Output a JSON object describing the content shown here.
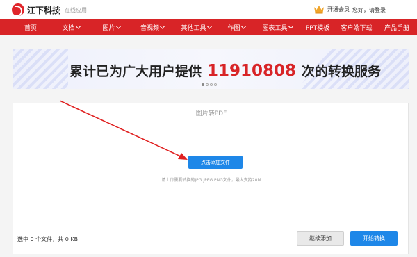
{
  "brand": {
    "name": "江下科技",
    "tagline": "在线应用",
    "accent": "#d82427",
    "blue": "#1e87e8"
  },
  "header": {
    "vip_label": "开通会员",
    "login_text": "您好，请登录",
    "vip_icon": "crown-icon"
  },
  "nav": {
    "items": [
      {
        "label": "首页",
        "dropdown": false
      },
      {
        "label": "文档",
        "dropdown": true
      },
      {
        "label": "图片",
        "dropdown": true
      },
      {
        "label": "音视频",
        "dropdown": true
      },
      {
        "label": "其他工具",
        "dropdown": true
      },
      {
        "label": "作图",
        "dropdown": true
      },
      {
        "label": "图表工具",
        "dropdown": true
      },
      {
        "label": "PPT模板",
        "dropdown": false
      },
      {
        "label": "客户端下载",
        "dropdown": false
      },
      {
        "label": "产品手册",
        "dropdown": false
      }
    ]
  },
  "banner": {
    "prefix": "累计已为广大用户提供",
    "count": "11910808",
    "suffix": "次的转换服务",
    "slides": 4,
    "active_slide": 1
  },
  "panel": {
    "title": "图片转PDF",
    "add_button": "点击添加文件",
    "hint": "请上传需要转换的JPG JPEG PNG文件，最大支持20M",
    "file_count": "选中 0 个文件，共 0 KB",
    "continue_button": "继续添加",
    "start_button": "开始转换"
  }
}
